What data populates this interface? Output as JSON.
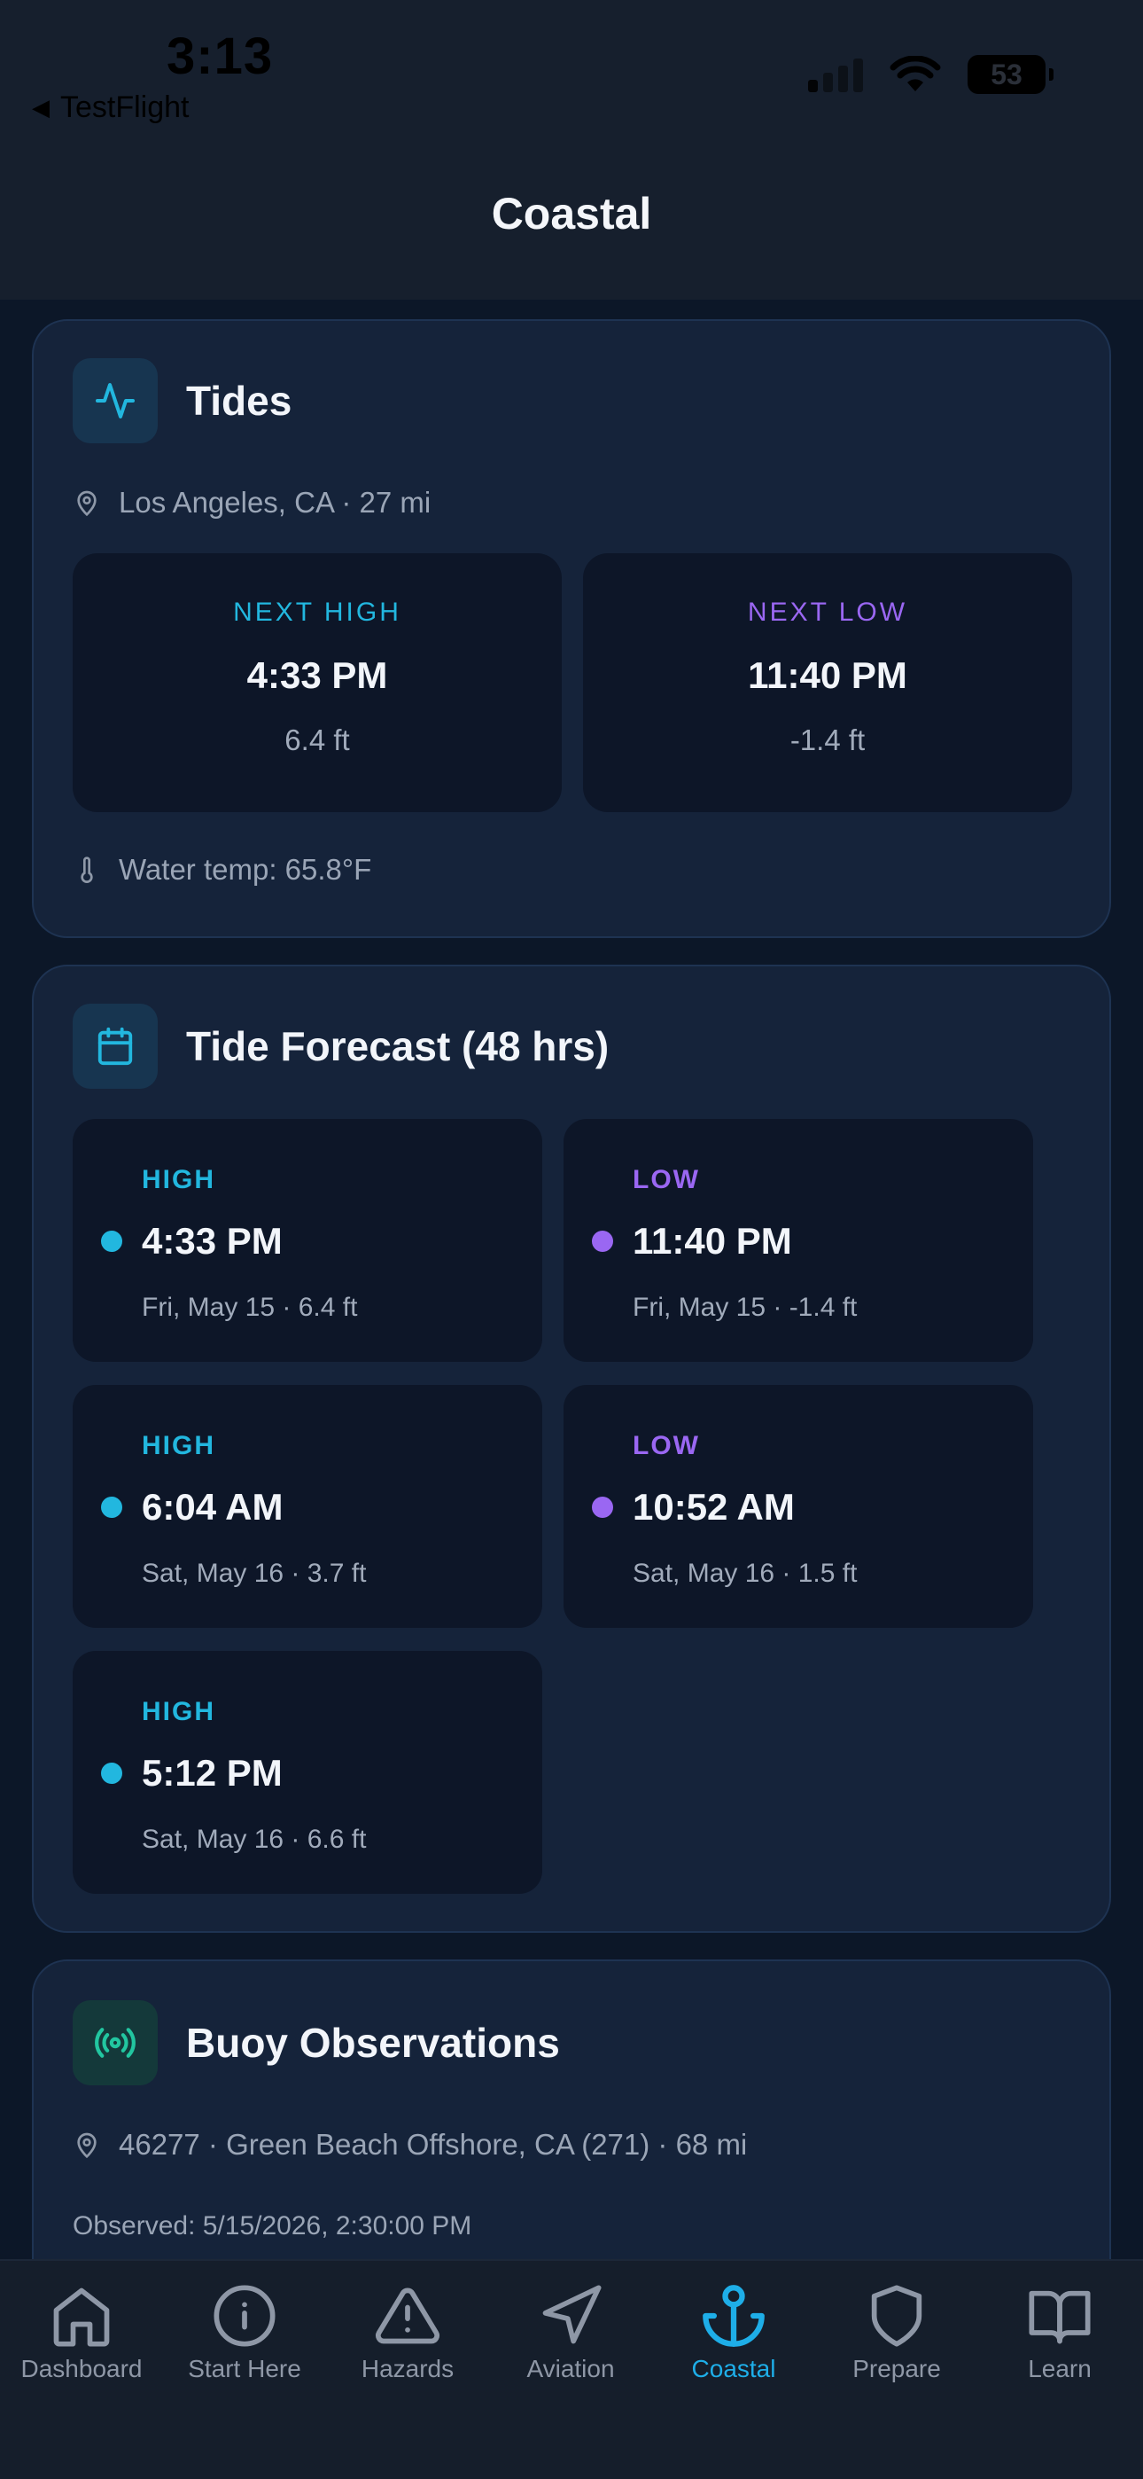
{
  "status": {
    "time": "3:13",
    "back_label": "TestFlight",
    "battery": "53"
  },
  "header": {
    "title": "Coastal"
  },
  "tides": {
    "title": "Tides",
    "location": "Los Angeles, CA · 27 mi",
    "next_high": {
      "label": "NEXT HIGH",
      "time": "4:33 PM",
      "height": "6.4 ft"
    },
    "next_low": {
      "label": "NEXT LOW",
      "time": "11:40 PM",
      "height": "-1.4 ft"
    },
    "water_temp": "Water temp: 65.8°F"
  },
  "forecast": {
    "title": "Tide Forecast (48 hrs)",
    "items": [
      {
        "type": "HIGH",
        "time": "4:33 PM",
        "detail": "Fri, May 15 · 6.4 ft"
      },
      {
        "type": "LOW",
        "time": "11:40 PM",
        "detail": "Fri, May 15 · -1.4 ft"
      },
      {
        "type": "HIGH",
        "time": "6:04 AM",
        "detail": "Sat, May 16 · 3.7 ft"
      },
      {
        "type": "LOW",
        "time": "10:52 AM",
        "detail": "Sat, May 16 · 1.5 ft"
      },
      {
        "type": "HIGH",
        "time": "5:12 PM",
        "detail": "Sat, May 16 · 6.6 ft"
      }
    ]
  },
  "buoy": {
    "title": "Buoy Observations",
    "station": "46277 · Green Beach Offshore, CA (271) · 68 mi",
    "observed": "Observed: 5/15/2026, 2:30:00 PM"
  },
  "tabs": [
    {
      "label": "Dashboard",
      "icon": "home-icon"
    },
    {
      "label": "Start Here",
      "icon": "info-icon"
    },
    {
      "label": "Hazards",
      "icon": "warning-icon"
    },
    {
      "label": "Aviation",
      "icon": "navigation-icon"
    },
    {
      "label": "Coastal",
      "icon": "anchor-icon"
    },
    {
      "label": "Prepare",
      "icon": "shield-icon"
    },
    {
      "label": "Learn",
      "icon": "book-icon"
    }
  ],
  "active_tab": "Coastal",
  "colors": {
    "high": "#22b7df",
    "low": "#9a67f2",
    "accent": "#1eaee8"
  }
}
